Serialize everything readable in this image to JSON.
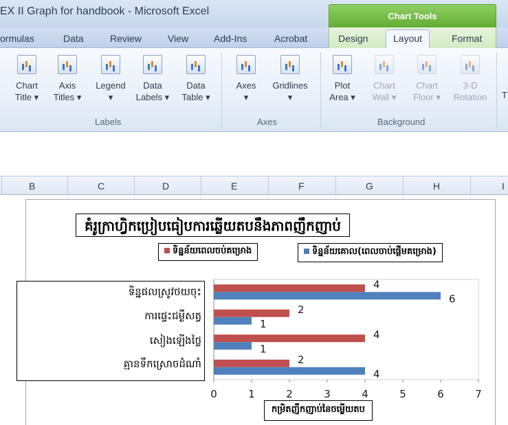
{
  "window": {
    "title": "EX II Graph for handbook - Microsoft Excel",
    "context_tab": "Chart Tools"
  },
  "tabs": [
    "ormulas",
    "Data",
    "Review",
    "View",
    "Add-Ins",
    "Acrobat",
    "Design",
    "Layout",
    "Format"
  ],
  "active_tab": "Layout",
  "ribbon": {
    "labels_group": {
      "name": "Labels",
      "buttons": [
        {
          "line1": "Chart",
          "line2": "Title ▾"
        },
        {
          "line1": "Axis",
          "line2": "Titles ▾"
        },
        {
          "line1": "Legend",
          "line2": "▾"
        },
        {
          "line1": "Data",
          "line2": "Labels ▾"
        },
        {
          "line1": "Data",
          "line2": "Table ▾"
        }
      ]
    },
    "axes_group": {
      "name": "Axes",
      "buttons": [
        {
          "line1": "Axes",
          "line2": "▾"
        },
        {
          "line1": "Gridlines",
          "line2": "▾"
        }
      ]
    },
    "background_group": {
      "name": "Background",
      "buttons": [
        {
          "line1": "Plot",
          "line2": "Area ▾"
        },
        {
          "line1": "Chart",
          "line2": "Wall ▾"
        },
        {
          "line1": "Chart",
          "line2": "Floor ▾"
        },
        {
          "line1": "3-D",
          "line2": "Rotation"
        }
      ]
    },
    "cut_off": "T"
  },
  "columns": [
    "B",
    "C",
    "D",
    "E",
    "F",
    "G",
    "H",
    "I"
  ],
  "colors": {
    "series_red": "#c0504d",
    "series_blue": "#4f81bd",
    "chart_tools_green": "#62ae35"
  },
  "chart_data": {
    "type": "bar",
    "orientation": "horizontal",
    "title": "គំរូក្រាហ្វិកប្រៀបធៀបការឆ្លើយតបនឹងភាពញឹកញាប់",
    "categories": [
      "ទិន្នផលស្រូវថយចុះ",
      "ការផ្ទេះជម្ងឺសត្វ",
      "សៀងឡើងថ្លៃ",
      "គ្មានទឹកស្រោចដំណាំ"
    ],
    "series": [
      {
        "name": "ទិន្នន័យពេលចប់គម្រោង",
        "color": "#c0504d",
        "values": [
          4,
          2,
          4,
          2
        ]
      },
      {
        "name": "ទិន្នន័យគោល(ពេលចាប់ផ្តើមគម្រោង)",
        "color": "#4f81bd",
        "values": [
          6,
          1,
          1,
          4
        ]
      }
    ],
    "xlabel": "កម្រិតញឹកញាប់នៃចម្លើយតប",
    "xlim": [
      0,
      7
    ],
    "xticks": [
      0,
      1,
      2,
      3,
      4,
      5,
      6,
      7
    ],
    "grid": false,
    "legend": "top"
  }
}
